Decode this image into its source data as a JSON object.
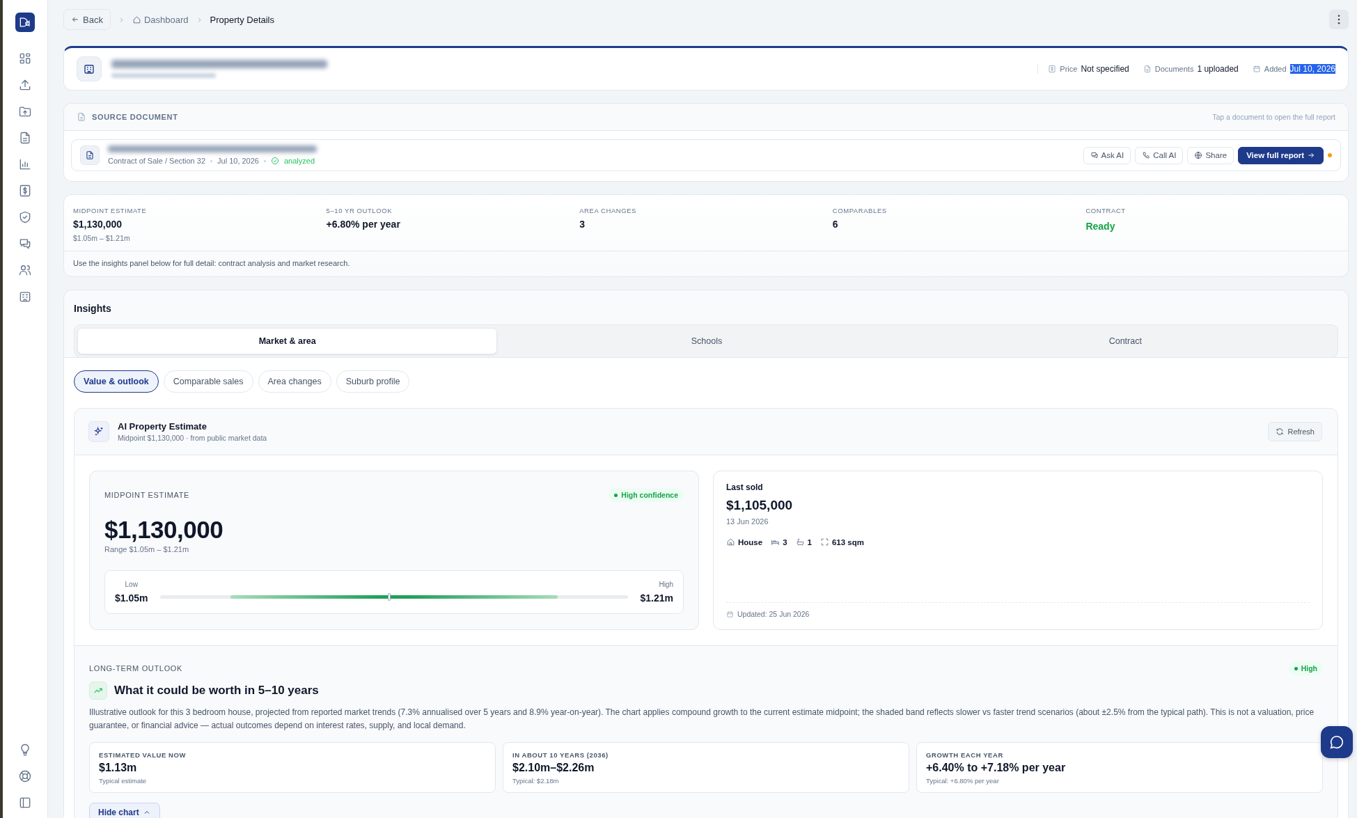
{
  "sidebar": {
    "nav": [
      {
        "kind": "grid"
      },
      {
        "kind": "upload"
      },
      {
        "kind": "folder"
      },
      {
        "kind": "file"
      },
      {
        "kind": "chart"
      },
      {
        "kind": "dollar"
      },
      {
        "kind": "shield"
      },
      {
        "kind": "chat"
      },
      {
        "kind": "users"
      },
      {
        "kind": "building"
      }
    ],
    "bottom": [
      {
        "kind": "bulb"
      },
      {
        "kind": "lifebuoy"
      },
      {
        "kind": "panel"
      }
    ]
  },
  "topbar": {
    "back": "Back",
    "breadcrumb": [
      "Dashboard",
      "Property Details"
    ]
  },
  "property": {
    "meta": [
      {
        "kind": "dollar",
        "label": "Price",
        "value": "Not specified",
        "highlighted": false
      },
      {
        "kind": "file",
        "label": "Documents",
        "value": "1 uploaded",
        "highlighted": false
      },
      {
        "kind": "calendar",
        "label": "Added",
        "value": "Jul 10, 2026",
        "highlighted": true
      }
    ]
  },
  "source_document": {
    "title": "SOURCE DOCUMENT",
    "hint": "Tap a document to open the full report",
    "doc": {
      "type": "Contract of Sale / Section 32",
      "date": "Jul 10, 2026",
      "status": "analyzed"
    },
    "actions": [
      {
        "kind": "chat",
        "label": "Ask AI",
        "primary": false
      },
      {
        "kind": "phone",
        "label": "Call AI",
        "primary": false
      },
      {
        "kind": "globe",
        "label": "Share",
        "primary": false
      },
      {
        "kind": "arrow",
        "label": "View full report",
        "primary": true
      }
    ]
  },
  "summary": {
    "items": [
      {
        "label": "MIDPOINT ESTIMATE",
        "value": "$1,130,000",
        "sub": "$1.05m – $1.21m",
        "positive": false
      },
      {
        "label": "5–10 YR OUTLOOK",
        "value": "+6.80% per year",
        "positive": false
      },
      {
        "label": "AREA CHANGES",
        "value": "3",
        "positive": false
      },
      {
        "label": "COMPARABLES",
        "value": "6",
        "positive": false
      },
      {
        "label": "CONTRACT",
        "value": "Ready",
        "positive": true
      }
    ],
    "note": "Use the insights panel below for full detail: contract analysis and market research."
  },
  "insights": {
    "title": "Insights",
    "tabs": [
      {
        "label": "Market & area",
        "selected": true
      },
      {
        "label": "Schools",
        "selected": false
      },
      {
        "label": "Contract",
        "selected": false
      }
    ],
    "subtabs": [
      {
        "label": "Value & outlook",
        "selected": true
      },
      {
        "label": "Comparable sales",
        "selected": false
      },
      {
        "label": "Area changes",
        "selected": false
      },
      {
        "label": "Suburb profile",
        "selected": false
      }
    ]
  },
  "estimate": {
    "title": "AI Property Estimate",
    "subtitle": "Midpoint $1,130,000 · from public market data",
    "refresh": "Refresh",
    "midpoint": {
      "label": "MIDPOINT ESTIMATE",
      "badge": "High confidence",
      "value": "$1,130,000",
      "range": "Range $1.05m – $1.21m",
      "low_label": "Low",
      "low": "$1.05m",
      "high_label": "High",
      "high": "$1.21m",
      "level": 0.49
    },
    "last_sold": {
      "title": "Last sold",
      "price": "$1,105,000",
      "date": "13 Jun 2026",
      "features": [
        {
          "kind": "house",
          "value": "House"
        },
        {
          "kind": "bed",
          "value": "3"
        },
        {
          "kind": "bath",
          "value": "1"
        },
        {
          "kind": "area",
          "value": "613 sqm"
        }
      ],
      "updated": "Updated: 25 Jun 2026"
    }
  },
  "outlook": {
    "label": "LONG-TERM OUTLOOK",
    "badge": "High",
    "title": "What it could be worth in 5–10 years",
    "text": "Illustrative outlook for this 3 bedroom house, projected from reported market trends (7.3% annualised over 5 years and 8.9% year-on-year). The chart applies compound growth to the current estimate midpoint; the shaded band reflects slower vs faster trend scenarios (about ±2.5% from the typical path). This is not a valuation, price guarantee, or financial advice — actual outcomes depend on interest rates, supply, and local demand.",
    "stats": [
      {
        "label": "ESTIMATED VALUE NOW",
        "value": "$1.13m",
        "sub": "Typical estimate"
      },
      {
        "label": "IN ABOUT 10 YEARS (2036)",
        "value": "$2.10m–$2.26m",
        "sub": "Typical: $2.18m"
      },
      {
        "label": "GROWTH EACH YEAR",
        "value": "+6.40% to +7.18% per year",
        "sub": "Typical: +6.80% per year"
      }
    ],
    "toggle": "Hide chart"
  }
}
